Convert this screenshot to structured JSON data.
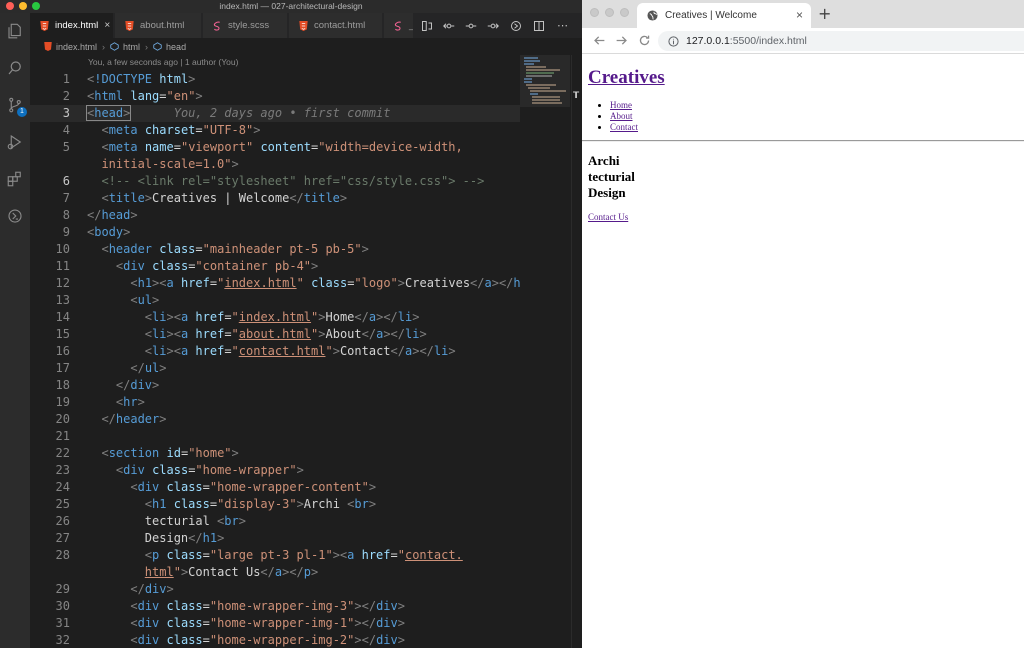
{
  "editor": {
    "window_title": "index.html — 027-architectural-design",
    "activity": {
      "icons": [
        "files-icon",
        "search-icon",
        "source-control-icon",
        "run-debug-icon",
        "extensions-icon",
        "remote-icon"
      ],
      "scm_badge": "1"
    },
    "tabs": [
      {
        "label": "index.html",
        "icon": "html-file-icon",
        "active": true,
        "close": "×"
      },
      {
        "label": "about.html",
        "icon": "html-file-icon",
        "active": false
      },
      {
        "label": "style.scss",
        "icon": "scss-file-icon",
        "active": false
      },
      {
        "label": "contact.html",
        "icon": "html-file-icon",
        "active": false
      },
      {
        "label": "_",
        "icon": "scss-file-icon",
        "active": false
      }
    ],
    "breadcrumb": [
      "index.html",
      "html",
      "head"
    ],
    "codelens": "You, a few seconds ago | 1 author (You)",
    "blame": "You, 2 days ago • first commit",
    "line_numbers": [
      "1",
      "2",
      "3",
      "4",
      "5",
      "",
      "6",
      "7",
      "8",
      "9",
      "10",
      "11",
      "12",
      "13",
      "14",
      "15",
      "16",
      "17",
      "18",
      "19",
      "20",
      "21",
      "22",
      "23",
      "24",
      "25",
      "26",
      "27",
      "28",
      "",
      "29",
      "30",
      "31",
      "32"
    ],
    "colors": {
      "tag": "#569cd6",
      "attr": "#9cdcfe",
      "string": "#ce9178",
      "comment": "#6a9955",
      "bracket": "#808080"
    }
  },
  "browser": {
    "tab_title": "Creatives | Welcome",
    "tab_close": "×",
    "new_tab": "+",
    "url_host": "127.0.0.1",
    "url_rest": ":5500/index.html",
    "page": {
      "logo": "Creatives",
      "nav": [
        "Home",
        "About",
        "Contact"
      ],
      "hero_lines": [
        "Archi",
        "tecturial",
        "Design"
      ],
      "cta": "Contact Us"
    }
  }
}
